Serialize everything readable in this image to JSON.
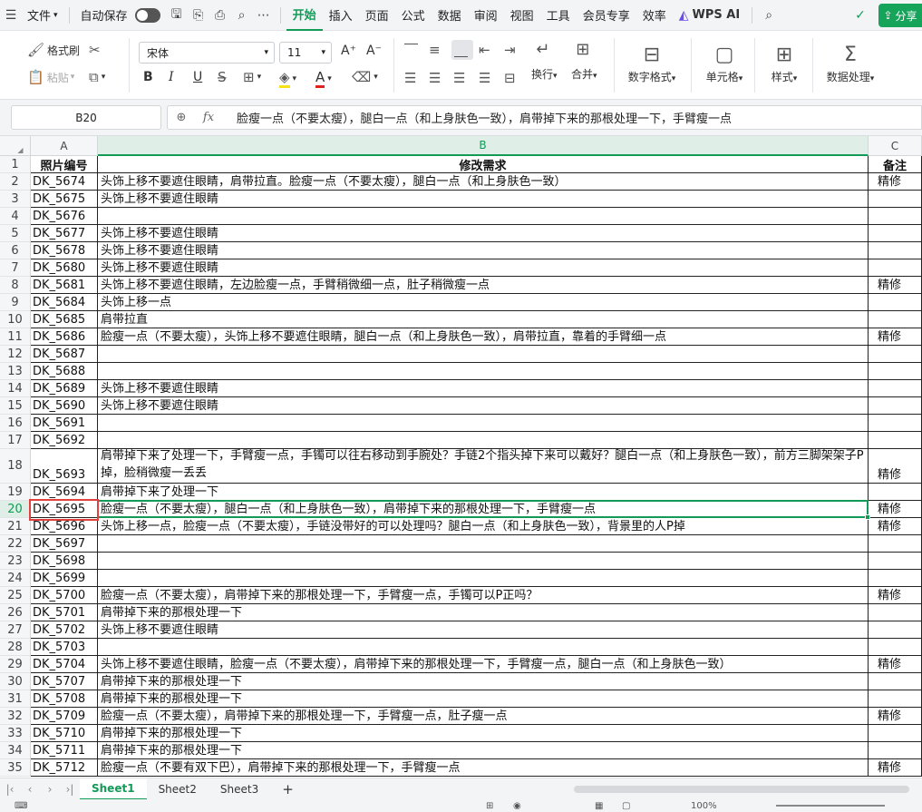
{
  "menubar": {
    "file_label": "文件",
    "autosave_label": "自动保存",
    "tabs": [
      "开始",
      "插入",
      "页面",
      "公式",
      "数据",
      "审阅",
      "视图",
      "工具",
      "会员专享",
      "效率"
    ],
    "wps_ai_label": "WPS AI",
    "share_label": "分享"
  },
  "ribbon": {
    "format_painter": "格式刷",
    "paste": "粘贴",
    "font_name": "宋体",
    "font_size": "11",
    "bold": "B",
    "italic": "I",
    "underline": "U",
    "wrap_label": "换行",
    "merge_label": "合并",
    "number_format_label": "数字格式",
    "cell_label": "单元格",
    "style_label": "样式",
    "data_processing_label": "数据处理"
  },
  "formula_bar": {
    "name_box": "B20",
    "formula": "脸瘦一点（不要太瘦），腿白一点（和上身肤色一致），肩带掉下来的那根处理一下，手臂瘦一点"
  },
  "columns": [
    "A",
    "B",
    "C"
  ],
  "header_row": {
    "a": "照片编号",
    "b": "修改需求",
    "c": "备注"
  },
  "rows": [
    {
      "n": "2",
      "a": "DK_5674",
      "b": "头饰上移不要遮住眼睛，肩带拉直。脸瘦一点（不要太瘦），腿白一点（和上身肤色一致）",
      "c": "精修"
    },
    {
      "n": "3",
      "a": "DK_5675",
      "b": "头饰上移不要遮住眼睛",
      "c": ""
    },
    {
      "n": "4",
      "a": "DK_5676",
      "b": "",
      "c": ""
    },
    {
      "n": "5",
      "a": "DK_5677",
      "b": "头饰上移不要遮住眼睛",
      "c": ""
    },
    {
      "n": "6",
      "a": "DK_5678",
      "b": "头饰上移不要遮住眼睛",
      "c": ""
    },
    {
      "n": "7",
      "a": "DK_5680",
      "b": "头饰上移不要遮住眼睛",
      "c": ""
    },
    {
      "n": "8",
      "a": "DK_5681",
      "b": "头饰上移不要遮住眼睛，左边脸瘦一点，手臂稍微细一点，肚子稍微瘦一点",
      "c": "精修"
    },
    {
      "n": "9",
      "a": "DK_5684",
      "b": "头饰上移一点",
      "c": ""
    },
    {
      "n": "10",
      "a": "DK_5685",
      "b": "肩带拉直",
      "c": ""
    },
    {
      "n": "11",
      "a": "DK_5686",
      "b": "脸瘦一点（不要太瘦），头饰上移不要遮住眼睛，腿白一点（和上身肤色一致），肩带拉直，靠着的手臂细一点",
      "c": "精修"
    },
    {
      "n": "12",
      "a": "DK_5687",
      "b": "",
      "c": ""
    },
    {
      "n": "13",
      "a": "DK_5688",
      "b": "",
      "c": ""
    },
    {
      "n": "14",
      "a": "DK_5689",
      "b": "头饰上移不要遮住眼睛",
      "c": ""
    },
    {
      "n": "15",
      "a": "DK_5690",
      "b": "头饰上移不要遮住眼睛",
      "c": ""
    },
    {
      "n": "16",
      "a": "DK_5691",
      "b": "",
      "c": ""
    },
    {
      "n": "17",
      "a": "DK_5692",
      "b": "",
      "c": ""
    },
    {
      "n": "18",
      "a": "DK_5693",
      "b": "肩带掉下来了处理一下，手臂瘦一点，手镯可以往右移动到手腕处？手链2个指头掉下来可以戴好？腿白一点（和上身肤色一致），前方三脚架架子P掉，脸稍微瘦一丢丢",
      "c": "精修"
    },
    {
      "n": "19",
      "a": "DK_5694",
      "b": "肩带掉下来了处理一下",
      "c": ""
    },
    {
      "n": "20",
      "a": "DK_5695",
      "b": "脸瘦一点（不要太瘦），腿白一点（和上身肤色一致），肩带掉下来的那根处理一下，手臂瘦一点",
      "c": "精修"
    },
    {
      "n": "21",
      "a": "DK_5696",
      "b": "头饰上移一点，脸瘦一点（不要太瘦），手链没带好的可以处理吗？腿白一点（和上身肤色一致），背景里的人P掉",
      "c": "精修"
    },
    {
      "n": "22",
      "a": "DK_5697",
      "b": "",
      "c": ""
    },
    {
      "n": "23",
      "a": "DK_5698",
      "b": "",
      "c": ""
    },
    {
      "n": "24",
      "a": "DK_5699",
      "b": "",
      "c": ""
    },
    {
      "n": "25",
      "a": "DK_5700",
      "b": "脸瘦一点（不要太瘦），肩带掉下来的那根处理一下，手臂瘦一点，手镯可以P正吗？",
      "c": "精修"
    },
    {
      "n": "26",
      "a": "DK_5701",
      "b": "肩带掉下来的那根处理一下",
      "c": ""
    },
    {
      "n": "27",
      "a": "DK_5702",
      "b": "头饰上移不要遮住眼睛",
      "c": ""
    },
    {
      "n": "28",
      "a": "DK_5703",
      "b": "",
      "c": ""
    },
    {
      "n": "29",
      "a": "DK_5704",
      "b": "头饰上移不要遮住眼睛，脸瘦一点（不要太瘦），肩带掉下来的那根处理一下，手臂瘦一点，腿白一点（和上身肤色一致）",
      "c": "精修"
    },
    {
      "n": "30",
      "a": "DK_5707",
      "b": "肩带掉下来的那根处理一下",
      "c": ""
    },
    {
      "n": "31",
      "a": "DK_5708",
      "b": "肩带掉下来的那根处理一下",
      "c": ""
    },
    {
      "n": "32",
      "a": "DK_5709",
      "b": "脸瘦一点（不要太瘦），肩带掉下来的那根处理一下，手臂瘦一点，肚子瘦一点",
      "c": "精修"
    },
    {
      "n": "33",
      "a": "DK_5710",
      "b": "肩带掉下来的那根处理一下",
      "c": ""
    },
    {
      "n": "34",
      "a": "DK_5711",
      "b": "肩带掉下来的那根处理一下",
      "c": ""
    },
    {
      "n": "35",
      "a": "DK_5712",
      "b": "脸瘦一点（不要有双下巴），肩带掉下来的那根处理一下，手臂瘦一点",
      "c": "精修"
    }
  ],
  "sheets": [
    "Sheet1",
    "Sheet2",
    "Sheet3"
  ],
  "status": {
    "zoom": "100%"
  },
  "colors": {
    "accent": "#129b57",
    "highlight": "#e0413c"
  }
}
